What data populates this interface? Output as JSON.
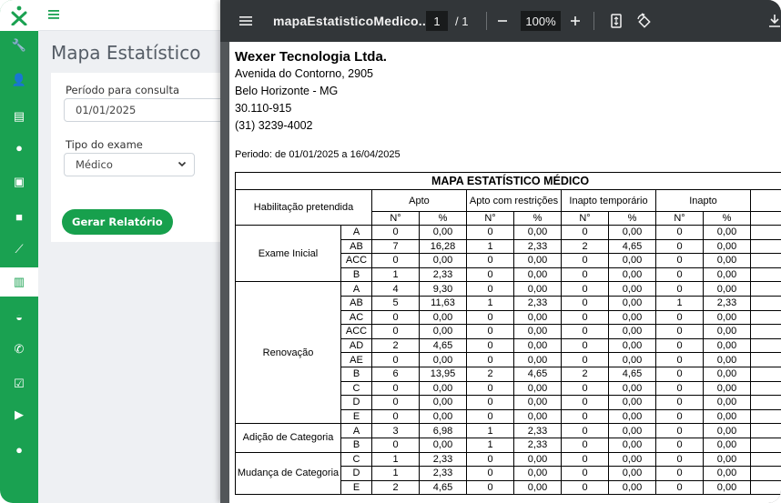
{
  "app": {
    "brand_color": "#1aa151",
    "sidebar_icons": [
      "wrench-icon",
      "user-plus-icon",
      "document-icon",
      "user-icon",
      "money-icon",
      "note-icon",
      "line-chart-icon",
      "bar-chart-icon",
      "dashboard-icon",
      "phone-icon",
      "calendar-check-icon",
      "play-icon",
      "user-icon"
    ],
    "active_icon": "bar-chart-icon"
  },
  "page": {
    "title": "Mapa Estatístico",
    "periodo_label": "Período para consulta",
    "periodo_value": "01/01/2025",
    "tipo_label": "Tipo do exame",
    "tipo_value": "Médico",
    "button_label": "Gerar Relatório"
  },
  "viewer": {
    "filename": "mapaEstatisticoMedico....",
    "page_current": "1",
    "page_sep": "/ 1",
    "zoom": "100%"
  },
  "report": {
    "company": "Wexer Tecnologia Ltda.",
    "address": [
      "Avenida do Contorno, 2905",
      "Belo Horizonte - MG",
      "30.110-915",
      "(31) 3239-4002"
    ],
    "periodo": "Periodo: de 01/01/2025 a 16/04/2025",
    "table_title": "MAPA ESTATÍSTICO MÉDICO",
    "col_habilitacao": "Habilitação pretendida",
    "col_groups": [
      "Apto",
      "Apto com restrições",
      "Inapto temporário",
      "Inapto"
    ],
    "col_n": "N°",
    "col_pct": "%",
    "groups": [
      {
        "name": "Exame Inicial",
        "rows": [
          {
            "cat": "A",
            "v": [
              "0",
              "0,00",
              "0",
              "0,00",
              "0",
              "0,00",
              "0",
              "0,00"
            ]
          },
          {
            "cat": "AB",
            "v": [
              "7",
              "16,28",
              "1",
              "2,33",
              "2",
              "4,65",
              "0",
              "0,00"
            ]
          },
          {
            "cat": "ACC",
            "v": [
              "0",
              "0,00",
              "0",
              "0,00",
              "0",
              "0,00",
              "0",
              "0,00"
            ]
          },
          {
            "cat": "B",
            "v": [
              "1",
              "2,33",
              "0",
              "0,00",
              "0",
              "0,00",
              "0",
              "0,00"
            ]
          }
        ]
      },
      {
        "name": "Renovação",
        "rows": [
          {
            "cat": "A",
            "v": [
              "4",
              "9,30",
              "0",
              "0,00",
              "0",
              "0,00",
              "0",
              "0,00"
            ]
          },
          {
            "cat": "AB",
            "v": [
              "5",
              "11,63",
              "1",
              "2,33",
              "0",
              "0,00",
              "1",
              "2,33"
            ]
          },
          {
            "cat": "AC",
            "v": [
              "0",
              "0,00",
              "0",
              "0,00",
              "0",
              "0,00",
              "0",
              "0,00"
            ]
          },
          {
            "cat": "ACC",
            "v": [
              "0",
              "0,00",
              "0",
              "0,00",
              "0",
              "0,00",
              "0",
              "0,00"
            ]
          },
          {
            "cat": "AD",
            "v": [
              "2",
              "4,65",
              "0",
              "0,00",
              "0",
              "0,00",
              "0",
              "0,00"
            ]
          },
          {
            "cat": "AE",
            "v": [
              "0",
              "0,00",
              "0",
              "0,00",
              "0",
              "0,00",
              "0",
              "0,00"
            ]
          },
          {
            "cat": "B",
            "v": [
              "6",
              "13,95",
              "2",
              "4,65",
              "2",
              "4,65",
              "0",
              "0,00"
            ]
          },
          {
            "cat": "C",
            "v": [
              "0",
              "0,00",
              "0",
              "0,00",
              "0",
              "0,00",
              "0",
              "0,00"
            ]
          },
          {
            "cat": "D",
            "v": [
              "0",
              "0,00",
              "0",
              "0,00",
              "0",
              "0,00",
              "0",
              "0,00"
            ]
          },
          {
            "cat": "E",
            "v": [
              "0",
              "0,00",
              "0",
              "0,00",
              "0",
              "0,00",
              "0",
              "0,00"
            ]
          }
        ]
      },
      {
        "name": "Adição de Categoria",
        "rows": [
          {
            "cat": "A",
            "v": [
              "3",
              "6,98",
              "1",
              "2,33",
              "0",
              "0,00",
              "0",
              "0,00"
            ]
          },
          {
            "cat": "B",
            "v": [
              "0",
              "0,00",
              "1",
              "2,33",
              "0",
              "0,00",
              "0",
              "0,00"
            ]
          }
        ]
      },
      {
        "name": "Mudança de Categoria",
        "rows": [
          {
            "cat": "C",
            "v": [
              "1",
              "2,33",
              "0",
              "0,00",
              "0",
              "0,00",
              "0",
              "0,00"
            ]
          },
          {
            "cat": "D",
            "v": [
              "1",
              "2,33",
              "0",
              "0,00",
              "0",
              "0,00",
              "0",
              "0,00"
            ]
          },
          {
            "cat": "E",
            "v": [
              "2",
              "4,65",
              "0",
              "0,00",
              "0",
              "0,00",
              "0",
              "0,00"
            ]
          }
        ]
      }
    ]
  }
}
